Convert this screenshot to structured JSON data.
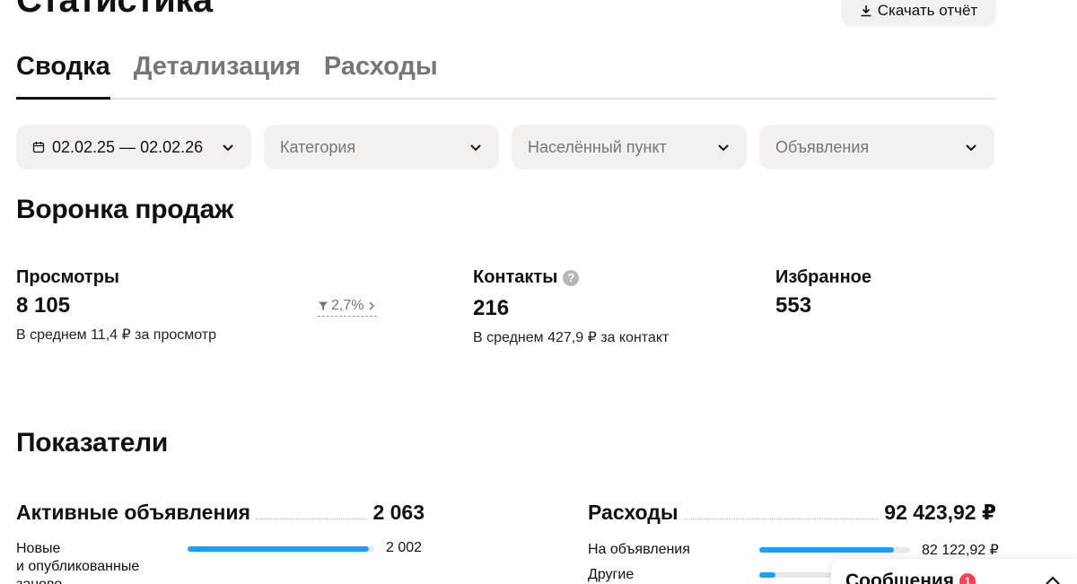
{
  "header": {
    "title": "Статистика",
    "download_label": "Скачать отчёт"
  },
  "tabs": [
    {
      "label": "Сводка",
      "active": true
    },
    {
      "label": "Детализация",
      "active": false
    },
    {
      "label": "Расходы",
      "active": false
    }
  ],
  "filters": {
    "date": "02.02.25 — 02.02.26",
    "category": "Категория",
    "city": "Населённый пункт",
    "ads": "Объявления"
  },
  "funnel": {
    "title": "Воронка продаж",
    "views": {
      "label": "Просмотры",
      "value": "8 105",
      "sub": "В среднем 11,4 ₽ за просмотр"
    },
    "conversion": "2,7%",
    "contacts": {
      "label": "Контакты",
      "help": "?",
      "value": "216",
      "sub": "В среднем 427,9 ₽ за контакт"
    },
    "favorites": {
      "label": "Избранное",
      "value": "553"
    }
  },
  "indicators": {
    "title": "Показатели",
    "active_ads": {
      "label": "Активные объявления",
      "value": "2 063",
      "rows": [
        {
          "label": "Новые\nи опубликованные\nзаново",
          "value": "2 002",
          "fraction": 0.97
        }
      ]
    },
    "expenses": {
      "label": "Расходы",
      "value": "92 423,92 ₽",
      "rows": [
        {
          "label": "На объявления",
          "value": "82 122,92 ₽",
          "fraction": 0.89
        },
        {
          "label": "Другие",
          "value": "",
          "fraction": 0.11
        }
      ]
    }
  },
  "messages": {
    "label": "Сообщения",
    "count": "1"
  },
  "colors": {
    "accent": "#1aa0ff",
    "badge": "#ff4053",
    "chip_bg": "#f2f1f0"
  }
}
